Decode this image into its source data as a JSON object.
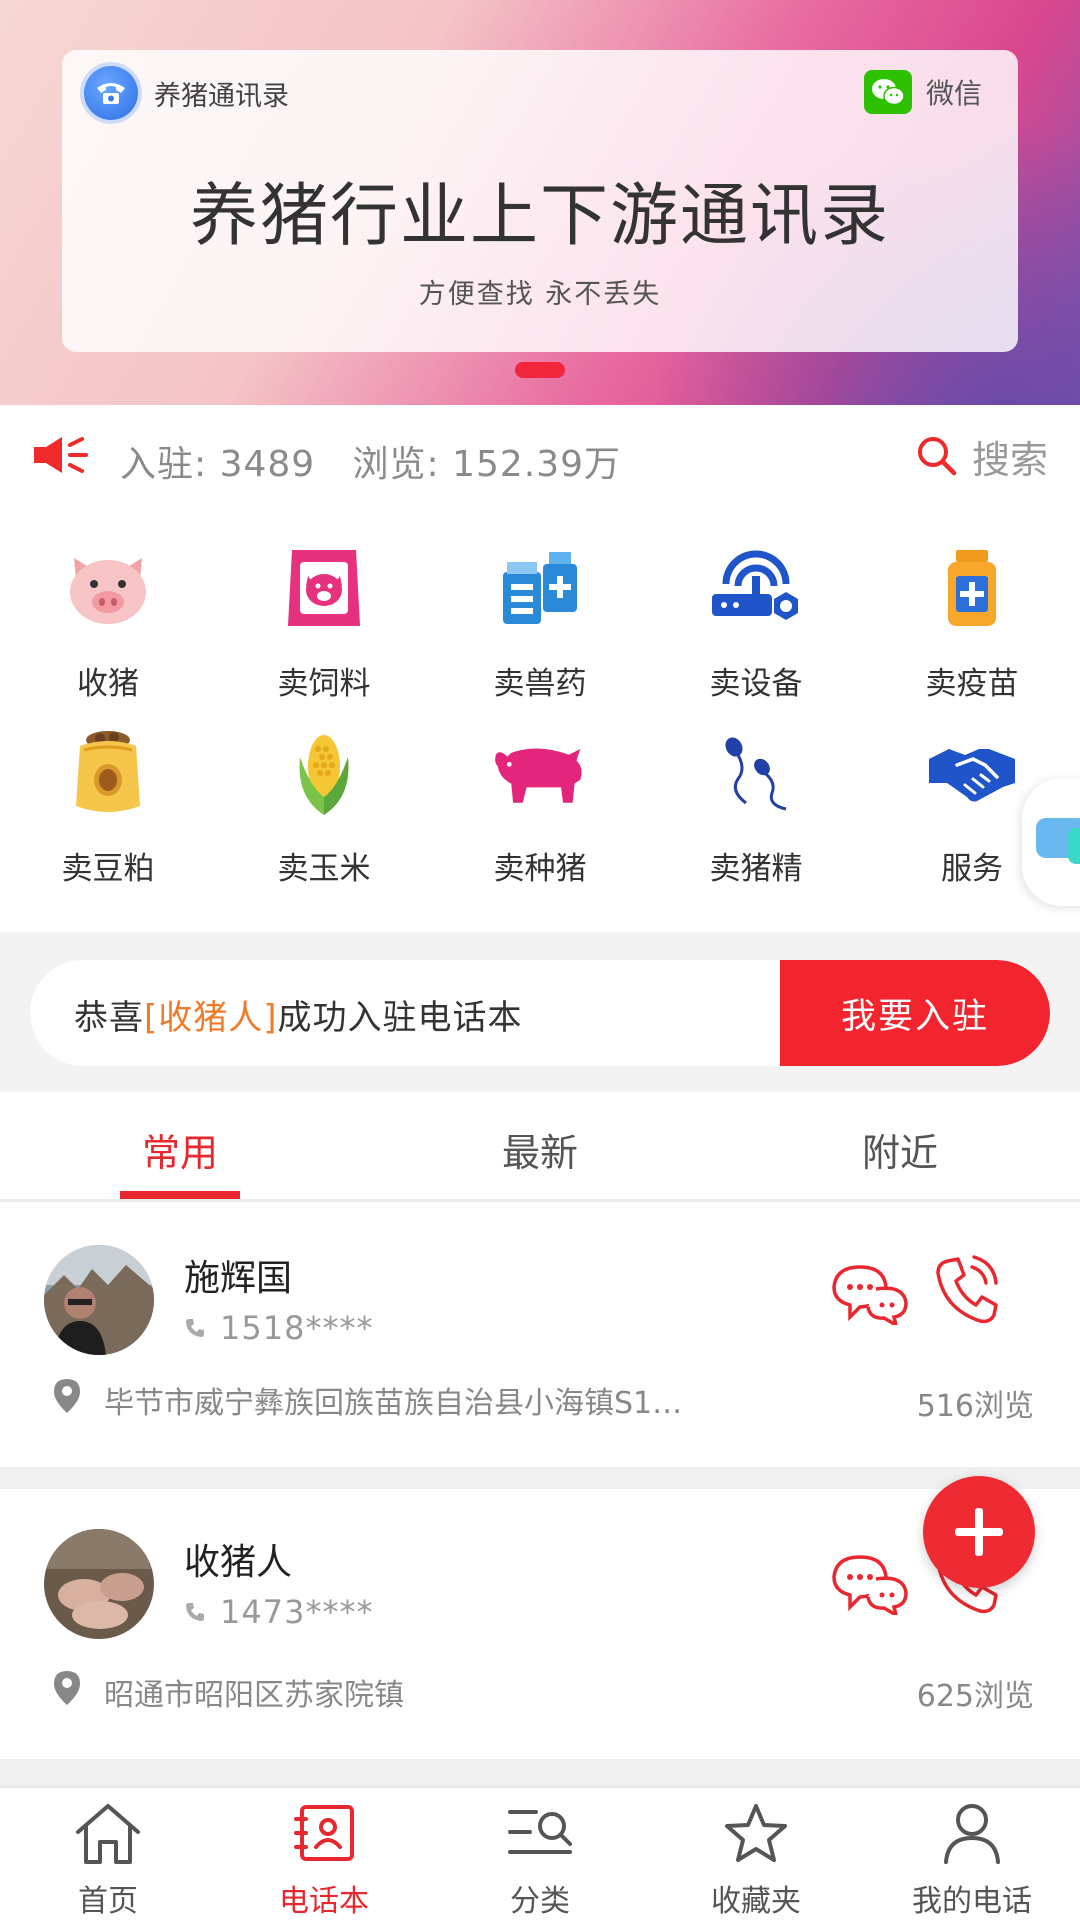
{
  "banner": {
    "brand_name": "养猪通讯录",
    "wechat_label": "微信",
    "title": "养猪行业上下游通讯录",
    "subtitle": "方便查找 永不丢失"
  },
  "stats": {
    "text": "入驻: 3489   浏览: 152.39万",
    "search_label": "搜索"
  },
  "categories": [
    {
      "label": "收猪",
      "icon": "pig-face-icon"
    },
    {
      "label": "卖饲料",
      "icon": "feed-bag-icon"
    },
    {
      "label": "卖兽药",
      "icon": "medicine-bottles-icon"
    },
    {
      "label": "卖设备",
      "icon": "equipment-icon"
    },
    {
      "label": "卖疫苗",
      "icon": "vaccine-bottle-icon"
    },
    {
      "label": "卖豆粕",
      "icon": "soybean-bag-icon"
    },
    {
      "label": "卖玉米",
      "icon": "corn-icon"
    },
    {
      "label": "卖种猪",
      "icon": "breeding-pig-icon"
    },
    {
      "label": "卖猪精",
      "icon": "sperm-icon"
    },
    {
      "label": "服务",
      "icon": "handshake-icon"
    }
  ],
  "notice": {
    "prefix": "恭喜",
    "highlight": "[收猪人]",
    "suffix": "成功入驻电话本",
    "join_label": "我要入驻"
  },
  "tabs": [
    {
      "label": "常用",
      "active": true
    },
    {
      "label": "最新",
      "active": false
    },
    {
      "label": "附近",
      "active": false
    }
  ],
  "contacts": [
    {
      "name": "施辉国",
      "phone": "1518****",
      "address": "毕节市威宁彝族回族苗族自治县小海镇S1…",
      "views": "516浏览"
    },
    {
      "name": "收猪人",
      "phone": "1473****",
      "address": "昭通市昭阳区苏家院镇",
      "views": "625浏览"
    }
  ],
  "bottom_nav": [
    {
      "label": "首页",
      "icon": "home-icon",
      "active": false
    },
    {
      "label": "电话本",
      "icon": "contacts-book-icon",
      "active": true
    },
    {
      "label": "分类",
      "icon": "category-search-icon",
      "active": false
    },
    {
      "label": "收藏夹",
      "icon": "star-icon",
      "active": false
    },
    {
      "label": "我的电话",
      "icon": "user-icon",
      "active": false
    }
  ],
  "colors": {
    "accent": "#e8282f",
    "highlight": "#f07b2a",
    "muted": "#888888"
  }
}
